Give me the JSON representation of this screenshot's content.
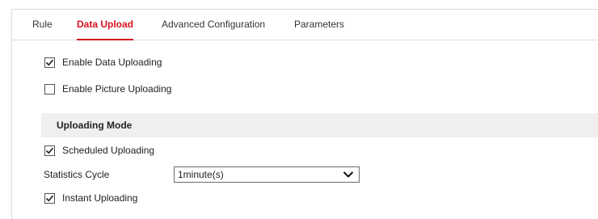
{
  "tabs": [
    {
      "label": "Rule",
      "active": false
    },
    {
      "label": "Data Upload",
      "active": true
    },
    {
      "label": "Advanced Configuration",
      "active": false
    },
    {
      "label": "Parameters",
      "active": false
    }
  ],
  "options": {
    "enable_data_uploading": {
      "label": "Enable Data Uploading",
      "checked": true
    },
    "enable_picture_uploading": {
      "label": "Enable Picture Uploading",
      "checked": false
    }
  },
  "uploading_mode": {
    "title": "Uploading Mode",
    "scheduled_uploading": {
      "label": "Scheduled Uploading",
      "checked": true
    },
    "statistics_cycle": {
      "label": "Statistics Cycle",
      "value": "1minute(s)"
    },
    "instant_uploading": {
      "label": "Instant Uploading",
      "checked": true
    }
  },
  "colors": {
    "accent": "#d7121f",
    "section_background": "#efefef"
  }
}
